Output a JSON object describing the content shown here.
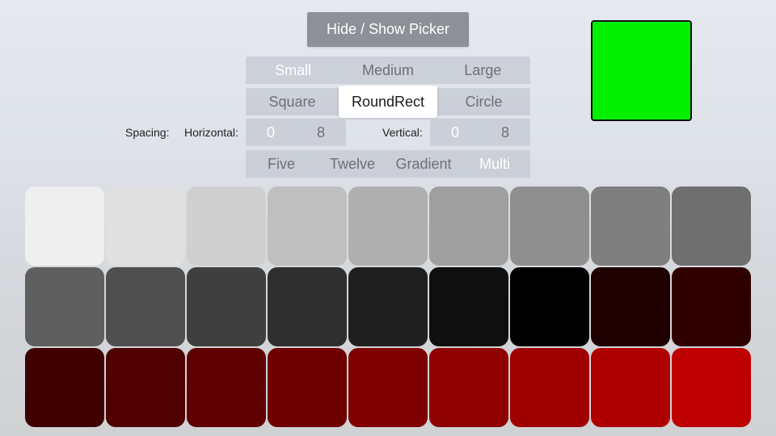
{
  "toggle_button": "Hide / Show Picker",
  "preview_color": "#00f000",
  "size_options": [
    "Small",
    "Medium",
    "Large"
  ],
  "selected_size": "Small",
  "shape_options": [
    "Square",
    "RoundRect",
    "Circle"
  ],
  "selected_shape": "RoundRect",
  "spacing": {
    "label": "Spacing:",
    "horizontal_label": "Horizontal:",
    "horizontal_options": [
      "0",
      "8"
    ],
    "vertical_label": "Vertical:",
    "vertical_options": [
      "0",
      "8"
    ]
  },
  "palette_options": [
    "Five",
    "Twelve",
    "Gradient",
    "Multi"
  ],
  "selected_palette": "Multi",
  "swatches": [
    "#efefef",
    "#e0e0e0",
    "#cfcfcf",
    "#bfbfbf",
    "#afafaf",
    "#9f9f9f",
    "#8f8f8f",
    "#7f7f7f",
    "#6f6f6f",
    "#5f5f5f",
    "#4f4f4f",
    "#3f3f3f",
    "#2f2f2f",
    "#1f1f1f",
    "#0f0f0f",
    "#000000",
    "#1f0000",
    "#2f0000",
    "#3f0000",
    "#4f0000",
    "#5f0000",
    "#6f0000",
    "#7f0000",
    "#8f0000",
    "#9f0000",
    "#af0000",
    "#bf0000"
  ]
}
